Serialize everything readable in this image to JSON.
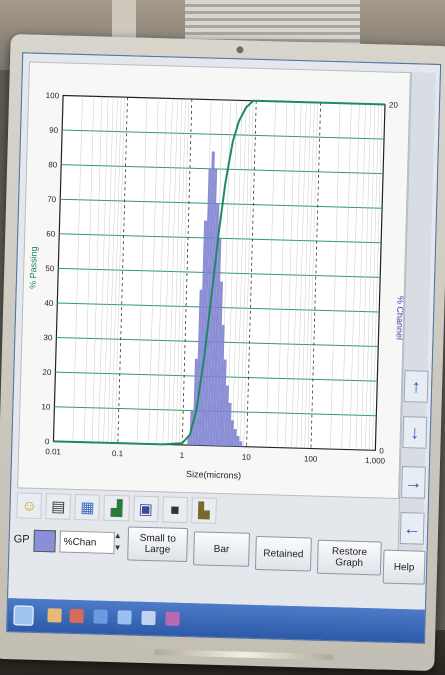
{
  "chart_data": {
    "type": "bar",
    "xlabel": "Size(microns)",
    "ylabel_left": "% Passing",
    "ylabel_right": "% Channel",
    "x_scale": "log",
    "xlim": [
      0.01,
      1000
    ],
    "ylim_left": [
      0,
      100
    ],
    "ylim_right": [
      0,
      20
    ],
    "x_ticks": [
      "0.01",
      "0.1",
      "1",
      "10",
      "100",
      "1,000"
    ],
    "y_ticks_left": [
      "0",
      "10",
      "20",
      "30",
      "40",
      "50",
      "60",
      "70",
      "80",
      "90",
      "100"
    ],
    "y_ticks_right": [
      "0",
      "20"
    ],
    "grid": true,
    "histogram": {
      "name": "% Channel",
      "color": "#7f82d2",
      "bins_x": [
        1.2,
        1.3,
        1.45,
        1.6,
        1.75,
        1.95,
        2.15,
        2.4,
        2.65,
        2.95,
        3.3,
        3.65,
        4.05,
        4.5,
        5.0,
        5.6,
        6.2,
        6.9,
        7.7
      ],
      "values": [
        0.5,
        2,
        5,
        9,
        13,
        16,
        17,
        16,
        14,
        12,
        9.5,
        7,
        5,
        3.5,
        2.5,
        1.5,
        1.0,
        0.6,
        0.3
      ]
    },
    "cumulative": {
      "name": "% Passing",
      "color": "#1d8a62",
      "x": [
        0.01,
        0.5,
        1.0,
        1.3,
        1.6,
        2.0,
        2.5,
        3.0,
        3.6,
        4.5,
        5.5,
        7,
        9,
        1000
      ],
      "values": [
        0,
        0,
        0.5,
        3,
        10,
        25,
        45,
        62,
        76,
        88,
        94,
        98,
        100,
        100
      ]
    }
  },
  "series_control": {
    "label": "GP",
    "swatch_color": "#8b8ed8",
    "selected": "%Chan"
  },
  "buttons": {
    "small_to_large": "Small to Large",
    "bar": "Bar",
    "retained": "Retained",
    "restore_graph": "Restore Graph",
    "help": "Help"
  },
  "side_arrows": {
    "up": "↑",
    "down": "↓",
    "right": "→",
    "left": "←"
  },
  "toolbar_icons": [
    "smiley-icon",
    "document-icon",
    "grid-icon",
    "chart-icon",
    "print-icon",
    "save-icon",
    "export-icon"
  ]
}
